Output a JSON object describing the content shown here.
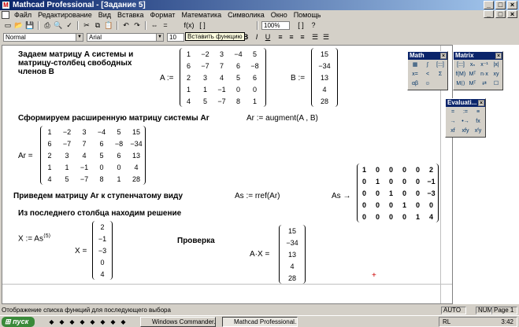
{
  "window": {
    "title": "Mathcad Professional - [Задание 5]",
    "app_icon": "mathcad-icon"
  },
  "window_buttons": {
    "minimize": "_",
    "maximize": "□",
    "close": "×"
  },
  "menu": [
    "Файл",
    "Редактирование",
    "Вид",
    "Вставка",
    "Формат",
    "Математика",
    "Символика",
    "Окно",
    "Помощь"
  ],
  "toolbar": {
    "zoom": "100%",
    "icons": {
      "new": "▭",
      "open": "📂",
      "save": "💾",
      "print": "⎙",
      "preview": "🔍",
      "spell": "✓",
      "cut": "✂",
      "copy": "⧉",
      "paste": "📋",
      "undo": "↶",
      "redo": "↷",
      "align": "⇔",
      "calc": "=",
      "insert_function": "f(x)",
      "insert_unit": "[ ]",
      "help": "?"
    }
  },
  "format_bar": {
    "style": "Normal",
    "font": "Arial",
    "size": "10",
    "bold": "B",
    "italic": "I",
    "underline": "U"
  },
  "tooltip": "Вставить функцию",
  "worksheet": {
    "text1": [
      "Задаем матрицу А системы и",
      "матрицу-столбец свободных",
      "членов В"
    ],
    "text2": "Сформируем расширенную матрицу системы Ar",
    "text3": "Приведем матрицу Ar к ступенчатому виду",
    "text4": "Из последнего столбца находим решение",
    "text5": "Проверка",
    "eq_A_label": "A :=",
    "eq_B_label": "B :=",
    "eq_Ar_def": "Ar := augment(A , B)",
    "eq_Ar_label": "Ar =",
    "eq_As_def": "As := rref(Ar)",
    "eq_As_label": "As →",
    "eq_X_def": "X := As",
    "eq_X_sup": "⟨5⟩",
    "eq_X_label": "X =",
    "eq_AX_label": "A·X =",
    "cursor_mark": "+",
    "A": [
      [
        1,
        -2,
        3,
        -4,
        5
      ],
      [
        6,
        -7,
        7,
        6,
        -8
      ],
      [
        2,
        3,
        4,
        5,
        6
      ],
      [
        1,
        1,
        -1,
        0,
        0
      ],
      [
        4,
        5,
        -7,
        8,
        1
      ]
    ],
    "B": [
      15,
      -34,
      13,
      4,
      28
    ],
    "Ar": [
      [
        1,
        -2,
        3,
        -4,
        5,
        15
      ],
      [
        6,
        -7,
        7,
        6,
        -8,
        -34
      ],
      [
        2,
        3,
        4,
        5,
        6,
        13
      ],
      [
        1,
        1,
        -1,
        0,
        0,
        4
      ],
      [
        4,
        5,
        -7,
        8,
        1,
        28
      ]
    ],
    "As": [
      [
        1,
        0,
        0,
        0,
        0,
        2
      ],
      [
        0,
        1,
        0,
        0,
        0,
        -1
      ],
      [
        0,
        0,
        1,
        0,
        0,
        -3
      ],
      [
        0,
        0,
        0,
        1,
        0,
        0
      ],
      [
        0,
        0,
        0,
        0,
        1,
        4
      ]
    ],
    "X": [
      2,
      -1,
      -3,
      0,
      4
    ],
    "AX": [
      15,
      -34,
      13,
      4,
      28
    ]
  },
  "palettes": {
    "math": {
      "title": "Math",
      "items": [
        "▦",
        "∫",
        "[:::]",
        "x=",
        "<",
        "Σ",
        "αβ",
        "☺"
      ]
    },
    "matrix": {
      "title": "Matrix",
      "items": [
        "[:::]",
        "xₙ",
        "x⁻¹",
        "|x|",
        "f(M)",
        "Mᵀ",
        "n·x",
        "xy",
        "M⟨⟩",
        "Mᵀ",
        "⇄",
        "☐"
      ]
    },
    "evaluation": {
      "title": "Evaluati...",
      "items": [
        "=",
        ":=",
        "≡",
        "→",
        "•→",
        "fx",
        "xf",
        "xfy",
        "xᶠy"
      ]
    }
  },
  "status": {
    "message": "Отображение списка функций для последующего выбора",
    "auto": "AUTO",
    "num": "NUM",
    "page": "Page 1"
  },
  "taskbar": {
    "start": "пуск",
    "tasks": [
      "Windows Commander...",
      "Mathcad Professional..."
    ],
    "lang": "RL",
    "time": "3:42"
  }
}
